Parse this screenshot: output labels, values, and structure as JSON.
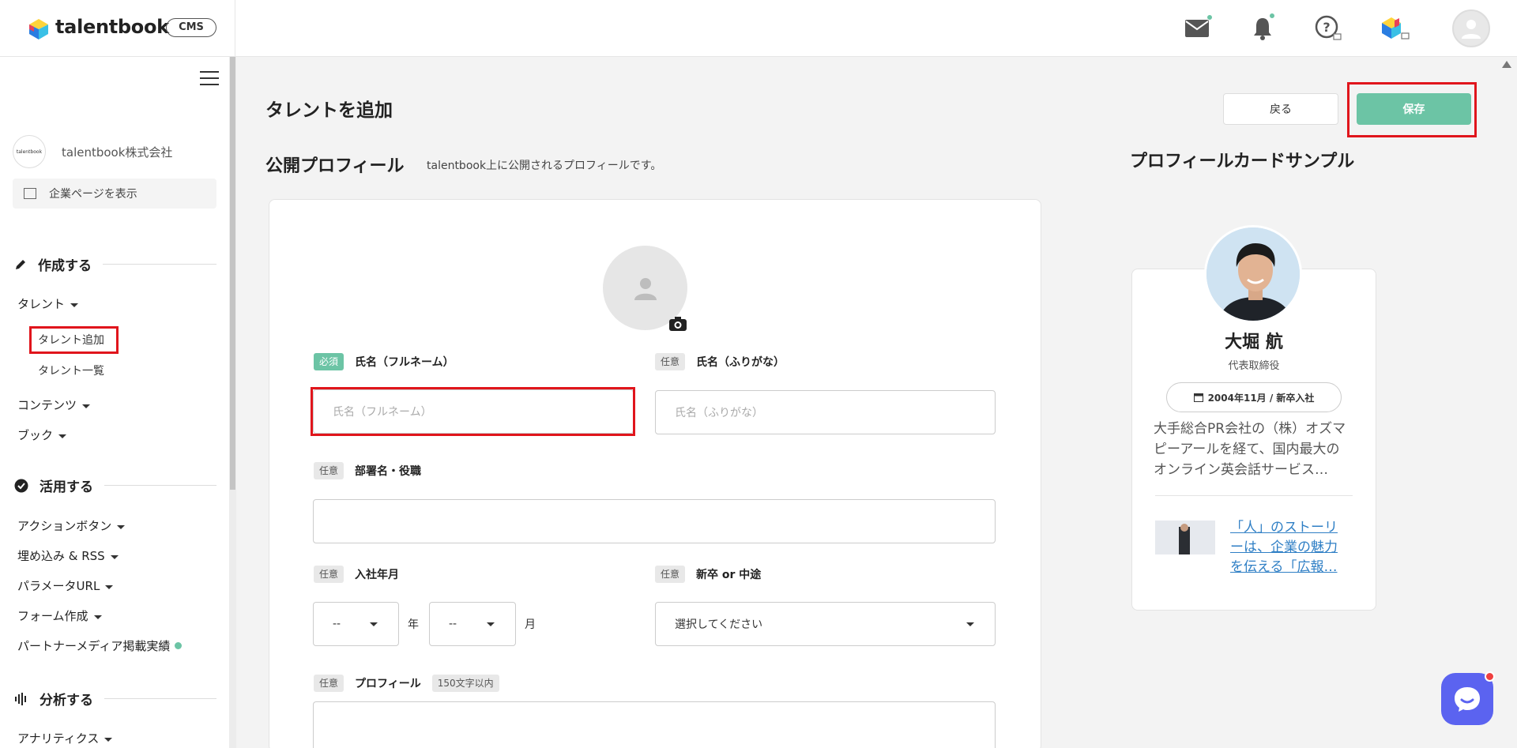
{
  "header": {
    "logo_text": "talentbook",
    "cms_label": "CMS"
  },
  "sidebar": {
    "company_name": "talentbook株式会社",
    "company_logo_text": "talentbook",
    "company_page_link": "企業ページを表示",
    "sections": {
      "create": "作成する",
      "use": "活用する",
      "analyze": "分析する"
    },
    "items": {
      "talent": "タレント",
      "talent_add": "タレント追加",
      "talent_list": "タレント一覧",
      "contents": "コンテンツ",
      "book": "ブック",
      "action_button": "アクションボタン",
      "embed_rss": "埋め込み & RSS",
      "param_url": "パラメータURL",
      "form_create": "フォーム作成",
      "partner_media": "パートナーメディア掲載実績",
      "analytics": "アナリティクス"
    }
  },
  "main": {
    "page_title": "タレントを追加",
    "back_button": "戻る",
    "save_button": "保存",
    "section_title": "公開プロフィール",
    "section_sub": "talentbook上に公開されるプロフィールです。",
    "form": {
      "tag_required": "必須",
      "tag_optional": "任意",
      "name_label": "氏名（フルネーム）",
      "name_placeholder": "氏名（フルネーム）",
      "kana_label": "氏名（ふりがな）",
      "kana_placeholder": "氏名（ふりがな）",
      "dept_label": "部署名・役職",
      "join_label": "入社年月",
      "year_value": "--",
      "year_unit": "年",
      "month_value": "--",
      "month_unit": "月",
      "hire_type_label": "新卒 or 中途",
      "hire_type_value": "選択してください",
      "profile_label": "プロフィール",
      "profile_limit": "150文字以内"
    }
  },
  "preview": {
    "title": "プロフィールカードサンプル",
    "name": "大堀 航",
    "role": "代表取締役",
    "date": "2004年11月 / 新卒入社",
    "description": "大手総合PR会社の（株）オズマピーアールを経て、国内最大のオンライン英会話サービス…",
    "story_link": "「人」のストーリーは、企業の魅力を伝える「広報…"
  },
  "colors": {
    "accent": "#6cc4a5",
    "highlight": "#e0151c",
    "link": "#2f7fc5",
    "chat": "#5b63f0"
  }
}
